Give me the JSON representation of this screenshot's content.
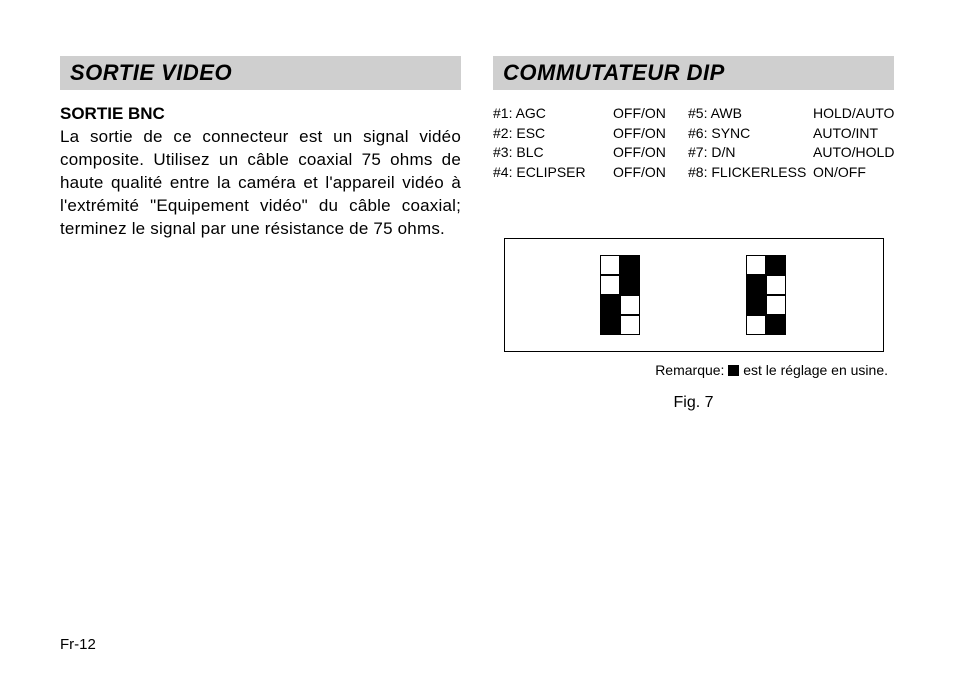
{
  "page_number": "Fr-12",
  "left": {
    "section_title": "SORTIE VIDEO",
    "sub_title": "SORTIE BNC",
    "body": "La sortie de ce connecteur est un signal vidéo composite. Utilisez un câble coaxial 75 ohms de haute qualité entre la caméra et l'appareil vidéo à l'extrémité \"Equipement vidéo\" du câble coaxial; terminez le signal par une résistance de 75 ohms."
  },
  "right": {
    "section_title": "COMMUTATEUR DIP",
    "dip_list": {
      "left_block": [
        {
          "label": "#1: AGC",
          "value": "OFF/ON"
        },
        {
          "label": "#2: ESC",
          "value": "OFF/ON"
        },
        {
          "label": "#3: BLC",
          "value": "OFF/ON"
        },
        {
          "label": "#4: ECLIPSER",
          "value": "OFF/ON"
        }
      ],
      "right_block": [
        {
          "label": "#5: AWB",
          "value": "HOLD/AUTO"
        },
        {
          "label": "#6: SYNC",
          "value": "AUTO/INT"
        },
        {
          "label": "#7: D/N",
          "value": "AUTO/HOLD"
        },
        {
          "label": "#8: FLICKERLESS",
          "value": "ON/OFF"
        }
      ]
    },
    "figure_note_prefix": "Remarque: ",
    "figure_note_suffix": " est le réglage en usine.",
    "figure_caption": "Fig. 7",
    "bank_left_filled": [
      1,
      3,
      4,
      6
    ],
    "bank_right_filled": [
      1,
      2,
      4,
      7
    ]
  }
}
